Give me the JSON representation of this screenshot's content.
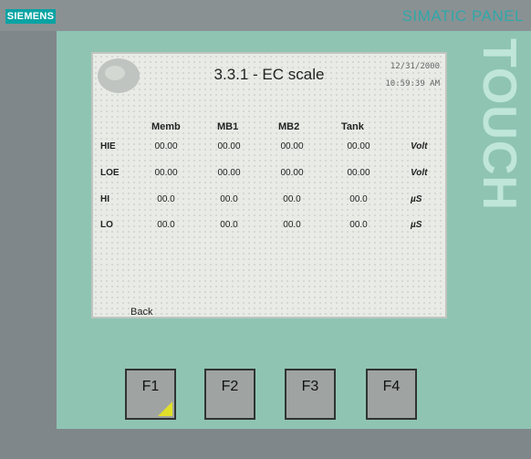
{
  "device": {
    "brand": "SIEMENS",
    "model": "SIMATIC PANEL",
    "side_text": "TOUCH"
  },
  "screen": {
    "title": "3.3.1 - EC scale",
    "date": "12/31/2000",
    "time": "10:59:39 AM",
    "columns": [
      "Memb",
      "MB1",
      "MB2",
      "Tank"
    ],
    "rows": [
      {
        "label": "HIE",
        "values": [
          "00.00",
          "00.00",
          "00.00",
          "00.00"
        ],
        "unit": "Volt"
      },
      {
        "label": "LOE",
        "values": [
          "00.00",
          "00.00",
          "00.00",
          "00.00"
        ],
        "unit": "Volt"
      },
      {
        "label": "HI",
        "values": [
          "00.0",
          "00.0",
          "00.0",
          "00.0"
        ],
        "unit": "µS"
      },
      {
        "label": "LO",
        "values": [
          "00.0",
          "00.0",
          "00.0",
          "00.0"
        ],
        "unit": "µS"
      }
    ],
    "back_label": "Back"
  },
  "function_keys": [
    {
      "label": "F1",
      "indicator": true
    },
    {
      "label": "F2"
    },
    {
      "label": "F3"
    },
    {
      "label": "F4"
    }
  ],
  "colors": {
    "accent": "#0aa3a3",
    "bezel": "#8fc4b3",
    "indicator": "#e0e02a"
  }
}
